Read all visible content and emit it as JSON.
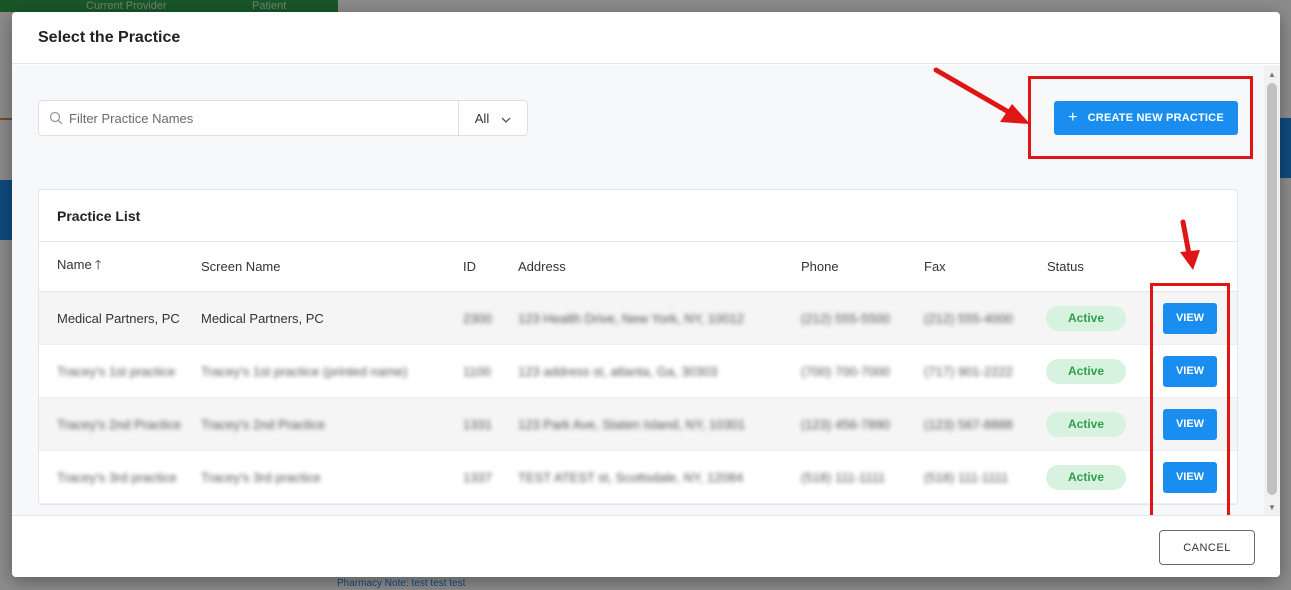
{
  "background": {
    "tab_current_provider": "Current Provider",
    "tab_patient": "Patient",
    "pharmacy_note": "Pharmacy Note: test test test"
  },
  "dialog": {
    "title": "Select the Practice",
    "search": {
      "placeholder": "Filter Practice Names",
      "icon": "search-icon"
    },
    "filter": {
      "selected": "All",
      "icon": "chevron-down-icon"
    },
    "create_button": {
      "label": "CREATE NEW PRACTICE",
      "icon": "+"
    },
    "cancel_label": "CANCEL"
  },
  "practice_list": {
    "title": "Practice List",
    "columns": {
      "name": "Name",
      "sort_indicator": "🡑",
      "screen_name": "Screen Name",
      "id": "ID",
      "address": "Address",
      "phone": "Phone",
      "fax": "Fax",
      "status": "Status"
    },
    "rows": [
      {
        "name": "Medical Partners, PC",
        "screen_name": "Medical Partners, PC",
        "id": "2300",
        "address": "123 Health Drive, New York, NY, 10012",
        "phone": "(212) 555-5500",
        "fax": "(212) 555-4000",
        "status": "Active",
        "action": "VIEW"
      },
      {
        "name": "Tracey's 1st practice",
        "screen_name": "Tracey's 1st practice (printed name)",
        "id": "1100",
        "address": "123 address st, atlanta, Ga, 30303",
        "phone": "(700) 700-7000",
        "fax": "(717) 901-2222",
        "status": "Active",
        "action": "VIEW"
      },
      {
        "name": "Tracey's 2nd Practice",
        "screen_name": "Tracey's 2nd Practice",
        "id": "1331",
        "address": "123 Park Ave, Staten Island, NY, 10301",
        "phone": "(123) 456-7890",
        "fax": "(123) 567-8888",
        "status": "Active",
        "action": "VIEW"
      },
      {
        "name": "Tracey's 3rd practice",
        "screen_name": "Tracey's 3rd practice",
        "id": "1337",
        "address": "TEST ATEST st, Scottsdale, NY, 12084",
        "phone": "(518) 111-1111",
        "fax": "(518) 111-1111",
        "status": "Active",
        "action": "VIEW"
      }
    ]
  },
  "colors": {
    "primary": "#1a8ef0",
    "status_active_bg": "#d7f2de",
    "status_active_text": "#2ea04b",
    "annotation_red": "#e01515"
  }
}
